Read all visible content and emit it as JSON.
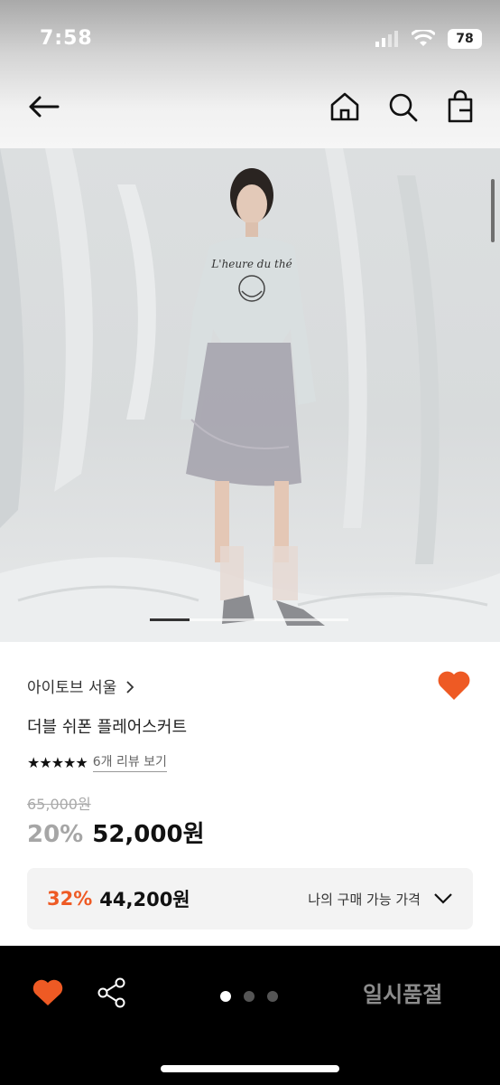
{
  "status": {
    "time": "7:58",
    "battery": "78"
  },
  "product": {
    "brand": "아이토브 서울",
    "name": "더블 쉬폰 플레어스커트",
    "stars": "★★★★★",
    "review_link": "6개 리뷰 보기",
    "original_price": "65,000원",
    "discount": "20%",
    "price": "52,000원"
  },
  "my_price": {
    "discount": "32%",
    "price": "44,200원",
    "label": "나의 구매 가능 가격"
  },
  "hero": {
    "shirt_text": "L'heure du thé"
  },
  "bottom": {
    "soldout_label": "일시품절",
    "pages": 3,
    "current_page": 1
  },
  "colors": {
    "accent": "#ee5a24",
    "bottom_bg": "#000000",
    "discount_gray": "#a6a6a6"
  }
}
